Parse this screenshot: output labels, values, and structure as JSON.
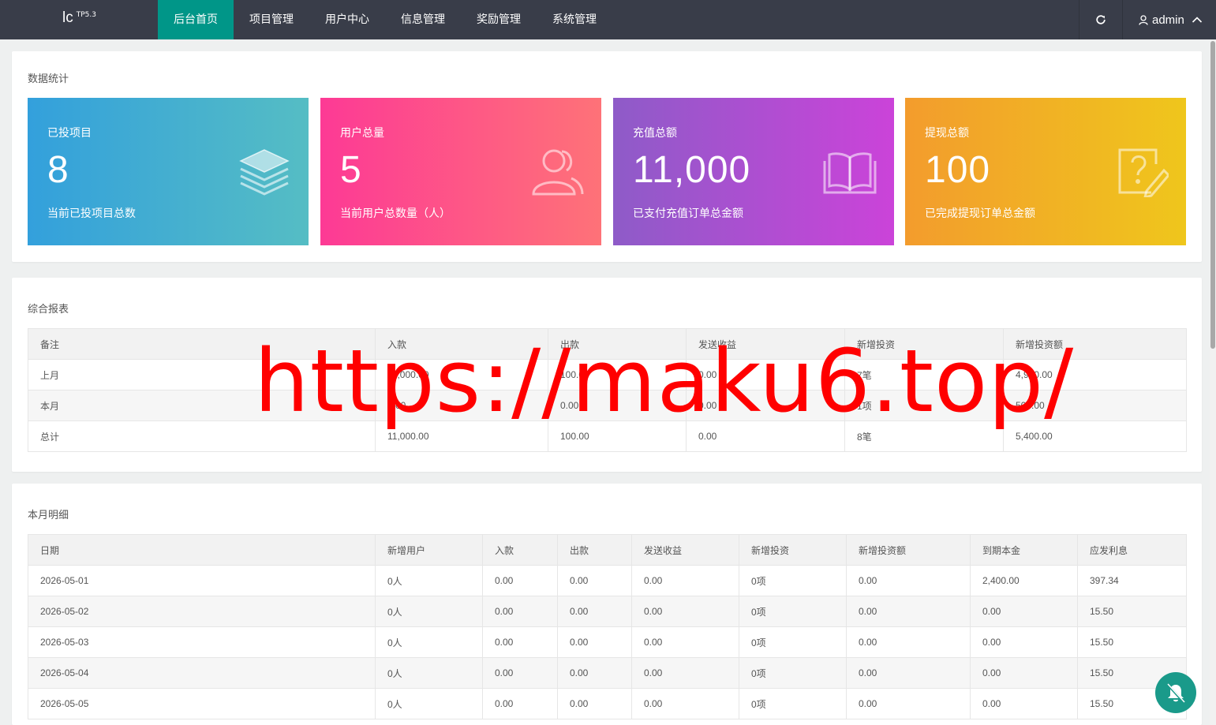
{
  "app": {
    "logo_text": "lc",
    "logo_version": "TP5.3"
  },
  "nav": [
    {
      "label": "后台首页",
      "active": true
    },
    {
      "label": "项目管理",
      "active": false
    },
    {
      "label": "用户中心",
      "active": false
    },
    {
      "label": "信息管理",
      "active": false
    },
    {
      "label": "奖励管理",
      "active": false
    },
    {
      "label": "系统管理",
      "active": false
    }
  ],
  "header": {
    "refresh_icon": "refresh-icon",
    "user_icon": "user-icon",
    "username": "admin",
    "chevron_icon": "chevron-up-icon"
  },
  "stats": {
    "title": "数据统计",
    "boxes": [
      {
        "label": "已投项目",
        "value": "8",
        "desc": "当前已投项目总数",
        "icon": "layers-icon"
      },
      {
        "label": "用户总量",
        "value": "5",
        "desc": "当前用户总数量（人）",
        "icon": "users-icon"
      },
      {
        "label": "充值总额",
        "value": "11,000",
        "desc": "已支付充值订单总金额",
        "icon": "book-icon"
      },
      {
        "label": "提现总额",
        "value": "100",
        "desc": "已完成提现订单总金额",
        "icon": "help-edit-icon"
      }
    ]
  },
  "report": {
    "title": "综合报表",
    "headers": [
      "备注",
      "入款",
      "出款",
      "发送收益",
      "新增投资",
      "新增投资额"
    ],
    "rows": [
      [
        "上月",
        "11,000.00",
        "100.00",
        "0.00",
        "7笔",
        "4,900.00"
      ],
      [
        "本月",
        "0.00",
        "0.00",
        "0.00",
        "1项",
        "500.00"
      ],
      [
        "总计",
        "11,000.00",
        "100.00",
        "0.00",
        "8笔",
        "5,400.00"
      ]
    ]
  },
  "monthly": {
    "title": "本月明细",
    "headers": [
      "日期",
      "新增用户",
      "入款",
      "出款",
      "发送收益",
      "新增投资",
      "新增投资额",
      "到期本金",
      "应发利息"
    ],
    "rows": [
      [
        "2026-05-01",
        "0人",
        "0.00",
        "0.00",
        "0.00",
        "0项",
        "0.00",
        "2,400.00",
        "397.34"
      ],
      [
        "2026-05-02",
        "0人",
        "0.00",
        "0.00",
        "0.00",
        "0项",
        "0.00",
        "0.00",
        "15.50"
      ],
      [
        "2026-05-03",
        "0人",
        "0.00",
        "0.00",
        "0.00",
        "0项",
        "0.00",
        "0.00",
        "15.50"
      ],
      [
        "2026-05-04",
        "0人",
        "0.00",
        "0.00",
        "0.00",
        "0项",
        "0.00",
        "0.00",
        "15.50"
      ],
      [
        "2026-05-05",
        "0人",
        "0.00",
        "0.00",
        "0.00",
        "0项",
        "0.00",
        "0.00",
        "15.50"
      ]
    ]
  },
  "watermark": "https://maku6.top/",
  "float_button": {
    "icon": "bell-off-icon"
  }
}
